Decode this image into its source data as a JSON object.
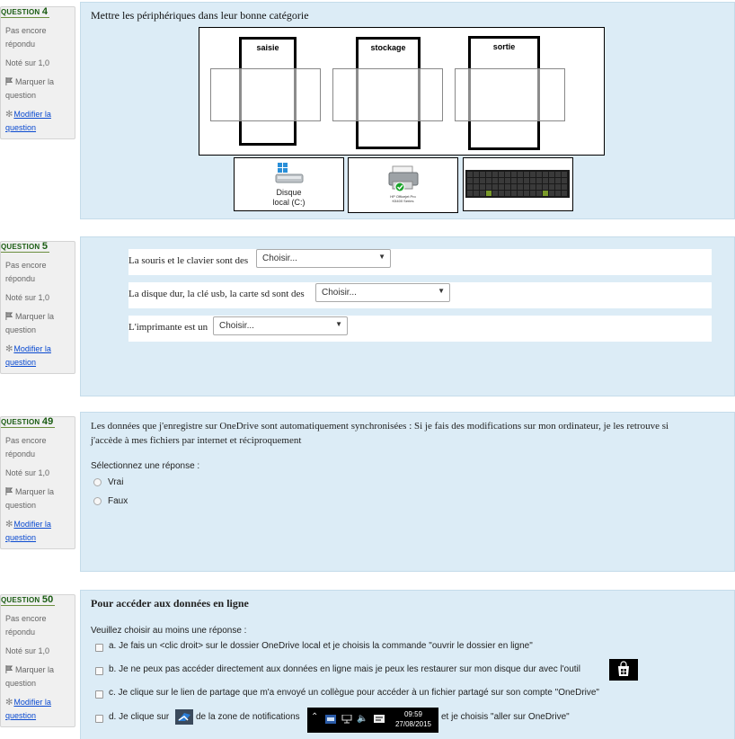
{
  "questions": [
    {
      "number_prefix": "QUESTION",
      "number": "4",
      "state_line1": "Pas encore",
      "state_line2": "répondu",
      "grade": "Noté sur 1,0",
      "flag_line1": "Marquer la",
      "flag_line2": "question",
      "edit_line1": "Modifier la",
      "edit_line2": "question",
      "title": "Mettre les périphériques dans leur bonne catégorie",
      "categories": [
        "saisie",
        "stockage",
        "sortie"
      ],
      "drag_items": [
        {
          "label_line1": "Disque",
          "label_line2": "local (C:)"
        },
        {
          "label_line1": "HP Officejet Pro",
          "label_line2": "K5400 Series"
        },
        {
          "label_line1": "",
          "label_line2": ""
        }
      ]
    },
    {
      "number_prefix": "QUESTION",
      "number": "5",
      "state_line1": "Pas encore",
      "state_line2": "répondu",
      "grade": "Noté sur 1,0",
      "flag_line1": "Marquer la",
      "flag_line2": "question",
      "edit_line1": "Modifier la",
      "edit_line2": "question",
      "rows": [
        {
          "text": "La souris et le clavier sont des",
          "select": "Choisir..."
        },
        {
          "text": "La disque dur, la clé usb, la carte sd sont des",
          "select": "Choisir..."
        },
        {
          "text": "L'imprimante est un",
          "select": "Choisir..."
        }
      ]
    },
    {
      "number_prefix": "QUESTION",
      "number": "49",
      "state_line1": "Pas encore",
      "state_line2": "répondu",
      "grade": "Noté sur 1,0",
      "flag_line1": "Marquer la",
      "flag_line2": "question",
      "edit_line1": "Modifier la",
      "edit_line2": "question",
      "text_line1": "Les données que j'enregistre sur OneDrive sont automatiquement synchronisées : Si je fais des modifications sur mon ordinateur, je les retrouve si",
      "text_line2": "j'accède à mes fichiers par internet et réciproquement",
      "prompt": "Sélectionnez une réponse :",
      "options": [
        "Vrai",
        "Faux"
      ]
    },
    {
      "number_prefix": "QUESTION",
      "number": "50",
      "state_line1": "Pas encore",
      "state_line2": "répondu",
      "grade": "Noté sur 1,0",
      "flag_line1": "Marquer la",
      "flag_line2": "question",
      "edit_line1": "Modifier la",
      "edit_line2": "question",
      "title": "Pour accéder aux données en ligne",
      "prompt": "Veuillez choisir au moins une réponse :",
      "option_a": "a. Je fais un <clic droit> sur le dossier OneDrive local et je choisis la commande \"ouvrir le dossier en ligne\"",
      "option_b": "b. Je ne peux pas accéder directement aux données en ligne mais je peux les restaurer sur mon disque dur avec l'outil",
      "option_c": "c. Je clique sur le lien de partage que m'a envoyé un collègue pour accéder à un fichier partagé sur son compte \"OneDrive\"",
      "option_d_pre": "d. Je clique sur",
      "option_d_mid": "de la zone de notifications",
      "option_d_post": "et je choisis \"aller sur OneDrive\"",
      "taskbar_time": "09:59",
      "taskbar_date": "27/08/2015"
    }
  ],
  "colors": {
    "panel_bg": "#dcecf6",
    "info_bg": "#f0f0f0",
    "link": "#0a4ad0",
    "question_number": "#1a5c12"
  }
}
